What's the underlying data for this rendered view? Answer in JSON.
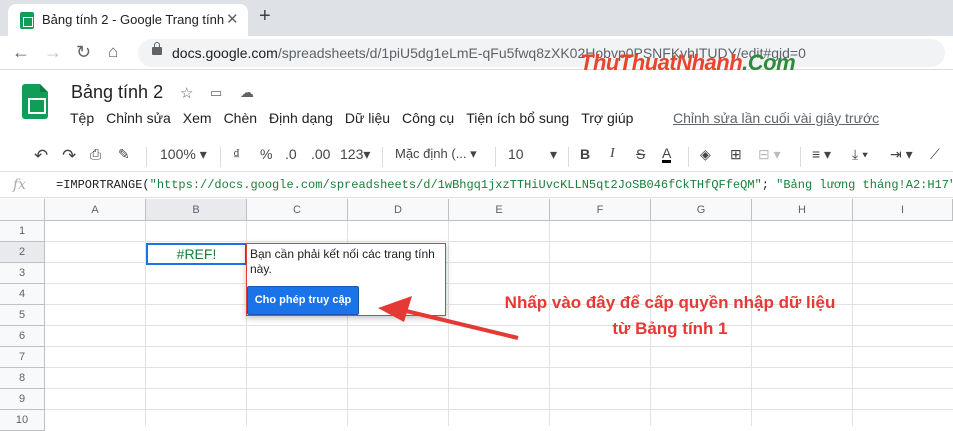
{
  "browser": {
    "tab_title": "Bảng tính 2 - Google Trang tính",
    "tab_close": "✕",
    "new_tab": "+",
    "url_host": "docs.google.com",
    "url_rest": "/spreadsheets/d/1piU5dg1eLmE-qFu5fwq8zXK02Hobvp0PSNFKvhITUDY/edit#gid=0"
  },
  "brand": {
    "text_a": "ThuThuat",
    "text_b": "Nhanh",
    "text_c": ".Com"
  },
  "app": {
    "doc_title": "Bảng tính 2",
    "menu": [
      "Tệp",
      "Chỉnh sửa",
      "Xem",
      "Chèn",
      "Định dạng",
      "Dữ liệu",
      "Công cụ",
      "Tiện ích bổ sung",
      "Trợ giúp"
    ],
    "last_edit": "Chỉnh sửa lần cuối vài giây trước"
  },
  "toolbar": {
    "zoom": "100%",
    "currency": "₫",
    "percent": "%",
    "dec_less": ".0",
    "dec_more": ".00",
    "format_more": "123",
    "font": "Mặc định (...",
    "font_size": "10",
    "bold": "B",
    "italic": "I",
    "strike": "S",
    "text_color": "A"
  },
  "formula": {
    "fx": "fx",
    "prefix": "=IMPORTRANGE(",
    "arg1": "\"https://docs.google.com/spreadsheets/d/1wBhgq1jxzTTHiUvcKLLN5qt2JoSB046fCkTHfQFfeQM\"",
    "sep": "; ",
    "arg2": "\"Bảng lương tháng!A2:H17\"",
    "suffix": ")"
  },
  "grid": {
    "columns": [
      "A",
      "B",
      "C",
      "D",
      "E",
      "F",
      "G",
      "H",
      "I"
    ],
    "rows": [
      "1",
      "2",
      "3",
      "4",
      "5",
      "6",
      "7",
      "8",
      "9",
      "10"
    ],
    "active_cell_value": "#REF!"
  },
  "popup": {
    "message": "Bạn cần phải kết nối các trang tính này.",
    "button": "Cho phép truy cập"
  },
  "annotation": {
    "line1": "Nhấp vào đây để cấp quyền nhập dữ liệu",
    "line2": "từ Bảng tính 1",
    "color": "#e53935"
  }
}
